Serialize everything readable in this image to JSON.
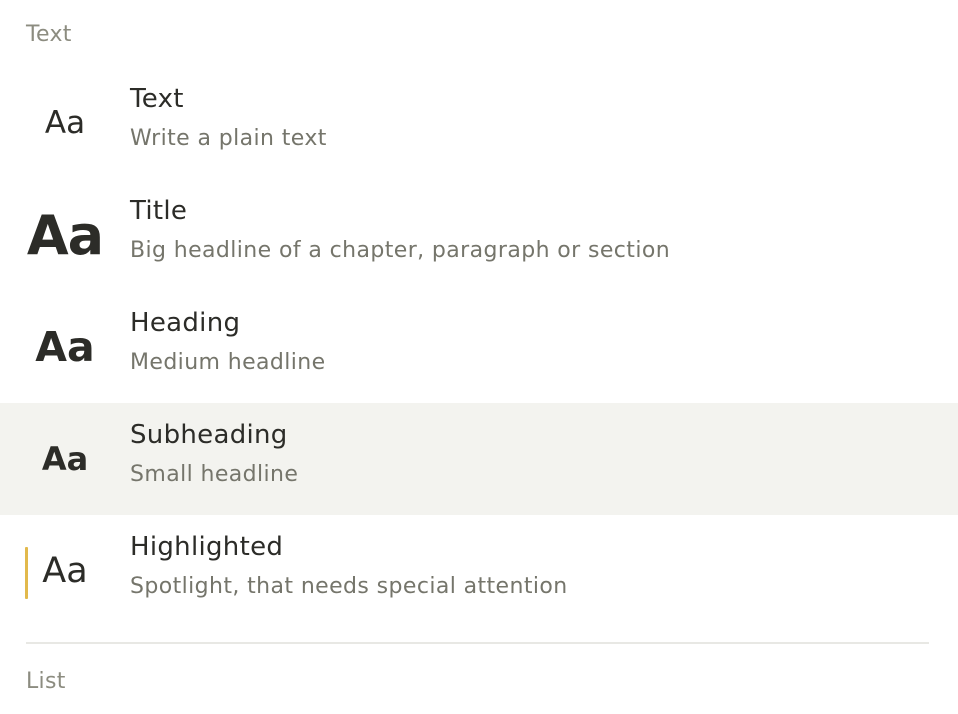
{
  "sections": {
    "text_label": "Text",
    "list_label": "List"
  },
  "items": [
    {
      "glyph": "Aa",
      "label": "Text",
      "description": "Write a plain text"
    },
    {
      "glyph": "Aa",
      "label": "Title",
      "description": "Big headline of a chapter, paragraph or section"
    },
    {
      "glyph": "Aa",
      "label": "Heading",
      "description": "Medium headline"
    },
    {
      "glyph": "Aa",
      "label": "Subheading",
      "description": "Small headline"
    },
    {
      "glyph": "Aa",
      "label": "Highlighted",
      "description": "Spotlight, that needs special attention"
    }
  ],
  "colors": {
    "hover_background": "#f3f3ef",
    "highlight_accent": "#e2b94c",
    "section_label": "#8c8c80",
    "description": "#75756b",
    "text": "#2c2c28"
  }
}
